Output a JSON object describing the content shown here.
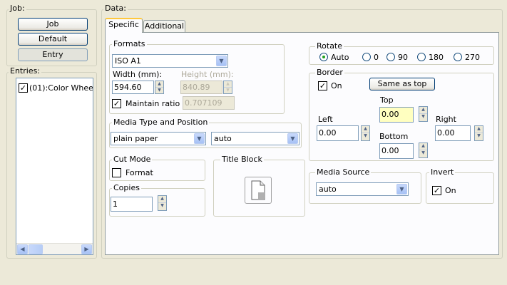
{
  "job": {
    "legend": "Job:",
    "job_button": "Job",
    "default_button": "Default",
    "entry_button": "Entry"
  },
  "entries": {
    "legend": "Entries:",
    "items": [
      {
        "label": "(01):Color Whee",
        "checked": true
      }
    ]
  },
  "data": {
    "legend": "Data:",
    "tabs": [
      "Specific",
      "Additional"
    ]
  },
  "formats": {
    "legend": "Formats",
    "selected": "ISO A1",
    "width_label": "Width (mm):",
    "height_label": "Height (mm):",
    "width_value": "594.60",
    "height_value": "840.89",
    "maintain_ratio_label": "Maintain ratio",
    "maintain_ratio_checked": true,
    "ratio_value": "0.707109"
  },
  "media": {
    "legend": "Media Type and Position",
    "type": "plain paper",
    "position": "auto"
  },
  "cut_mode": {
    "legend": "Cut Mode",
    "format_label": "Format",
    "format_checked": false
  },
  "copies": {
    "legend": "Copies",
    "value": "1"
  },
  "title_block": {
    "legend": "Title Block"
  },
  "rotate": {
    "legend": "Rotate",
    "options": [
      "Auto",
      "0",
      "90",
      "180",
      "270"
    ],
    "selected": "Auto"
  },
  "border": {
    "legend": "Border",
    "on_label": "On",
    "on_checked": true,
    "same_as_top_button": "Same as top",
    "top_label": "Top",
    "top_value": "0.00",
    "left_label": "Left",
    "left_value": "0.00",
    "right_label": "Right",
    "right_value": "0.00",
    "bottom_label": "Bottom",
    "bottom_value": "0.00"
  },
  "media_source": {
    "legend": "Media Source",
    "selected": "auto"
  },
  "invert": {
    "legend": "Invert",
    "on_label": "On",
    "on_checked": true
  },
  "colors": {
    "window_bg": "#ece9d8",
    "checkmark": "#21a121",
    "highlight_field": "#ffffc0",
    "xp_border": "#7f9db9"
  }
}
